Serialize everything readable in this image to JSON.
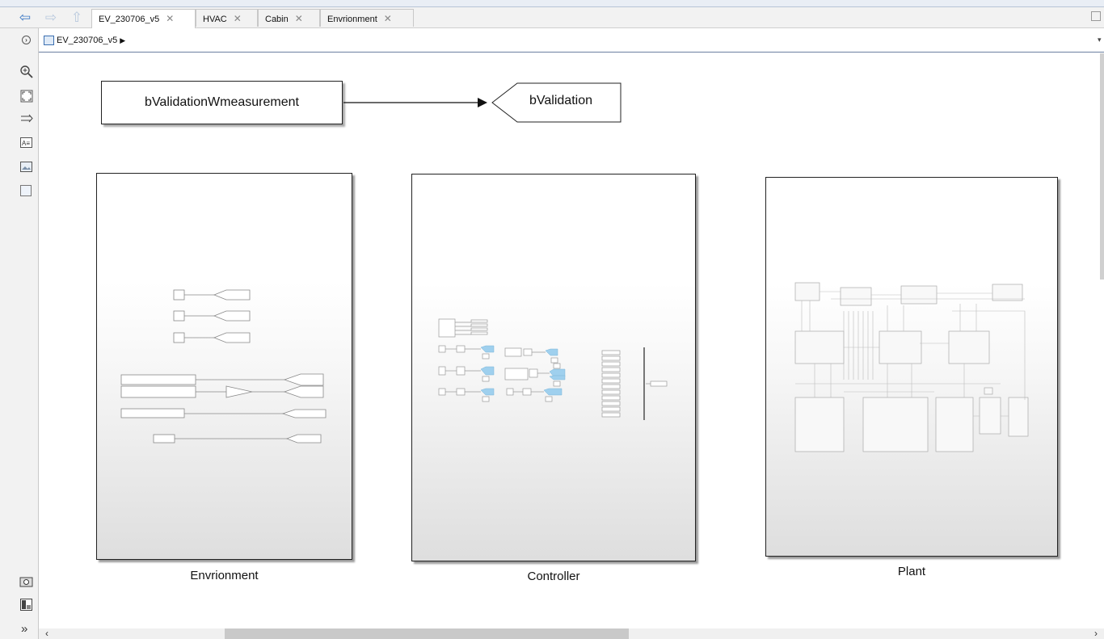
{
  "tabs": [
    {
      "label": "EV_230706_v5",
      "active": true
    },
    {
      "label": "HVAC",
      "active": false
    },
    {
      "label": "Cabin",
      "active": false
    },
    {
      "label": "Envrionment",
      "active": false
    }
  ],
  "tab_close_glyph": "✕",
  "breadcrumb": {
    "model": "EV_230706_v5",
    "arrow": "▶"
  },
  "diagram": {
    "from_block": "bValidationWmeasurement",
    "goto_block": "bValidation",
    "subsystems": [
      {
        "label": "Envrionment"
      },
      {
        "label": "Controller"
      },
      {
        "label": "Plant"
      }
    ]
  },
  "toolbar_icons": [
    "hide-explorer-icon",
    "zoom-icon",
    "fit-to-view-icon",
    "signal-arrow-icon",
    "annotation-icon",
    "image-icon",
    "area-icon",
    "screenshot-icon",
    "model-browser-icon",
    "more-icon"
  ],
  "colors": {
    "accent_nav": "#3b78c4",
    "inport_blue": "#9fd0ee"
  }
}
